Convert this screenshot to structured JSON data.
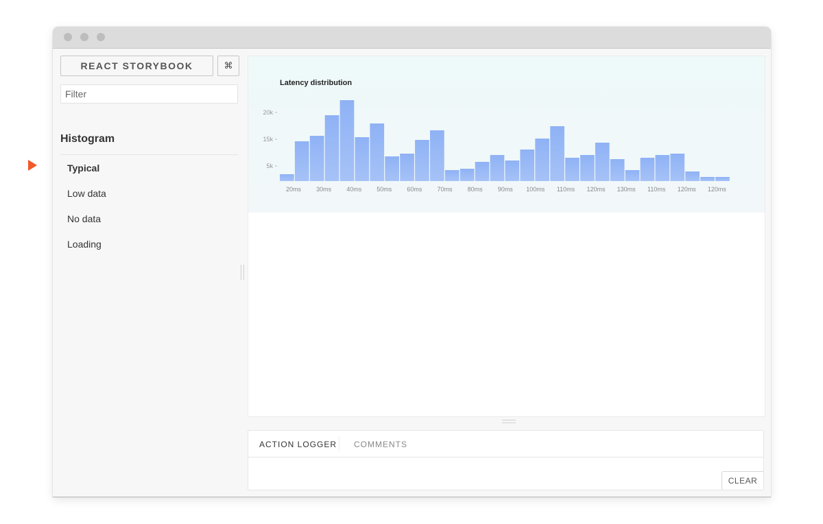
{
  "sidebar": {
    "title_button": "REACT STORYBOOK",
    "shortcut_icon": "⌘",
    "filter_placeholder": "Filter",
    "kind": "Histogram",
    "stories": [
      "Typical",
      "Low data",
      "No data",
      "Loading"
    ],
    "selected_story": "Typical"
  },
  "colors": {
    "pointer": "#f1592a",
    "bar": "#a6c2f7",
    "bar_top": "#8fb2f5",
    "chart_bg": "#eef9f9"
  },
  "chart_data": {
    "type": "bar",
    "title": "Latency distribution",
    "y_ticks": [
      "20k",
      "15k",
      "5k"
    ],
    "x_ticks": [
      "20ms",
      "30ms",
      "40ms",
      "50ms",
      "60ms",
      "70ms",
      "80ms",
      "90ms",
      "100ms",
      "110ms",
      "120ms",
      "130ms",
      "110ms",
      "120ms",
      "120ms"
    ],
    "values": [
      2.5,
      14.5,
      16.5,
      24,
      29.5,
      16,
      21,
      9,
      10,
      15,
      18.5,
      4,
      4.5,
      7,
      9.5,
      7.5,
      11.5,
      15.5,
      20,
      8.5,
      9.5,
      14,
      8,
      4,
      8.5,
      9.5,
      10,
      3.5,
      1.5,
      1.5
    ],
    "grid": false
  },
  "addons": {
    "tabs": [
      "ACTION LOGGER",
      "COMMENTS"
    ],
    "active_tab": "ACTION LOGGER",
    "clear_label": "CLEAR"
  }
}
